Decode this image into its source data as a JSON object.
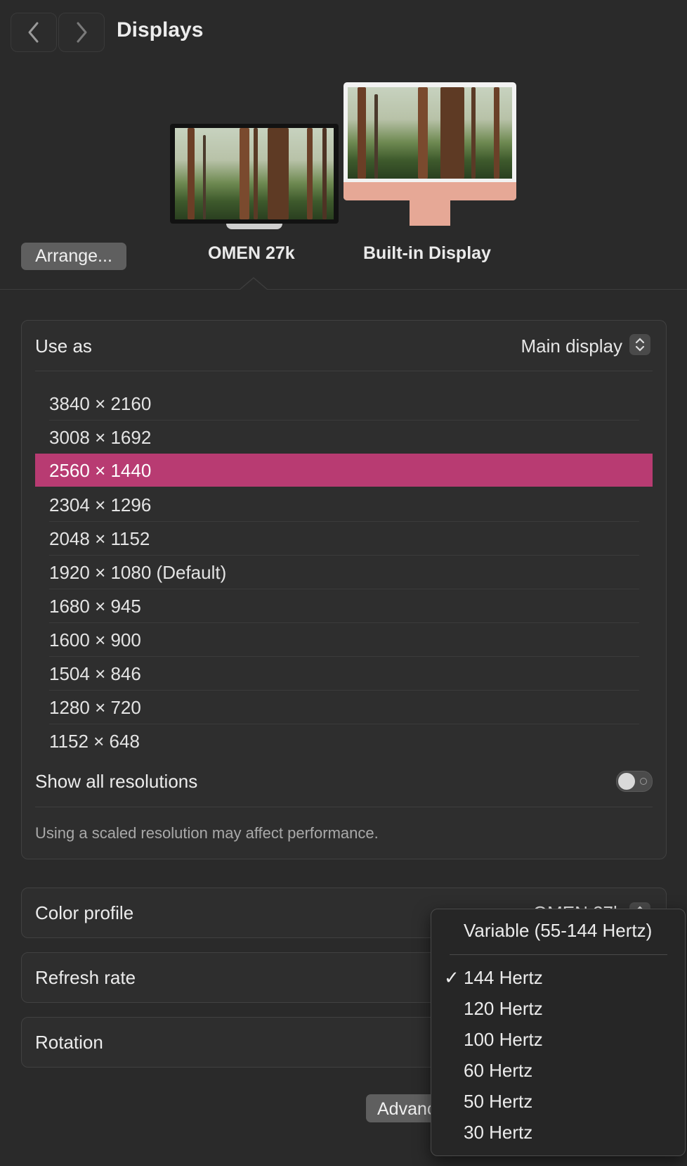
{
  "header": {
    "title": "Displays",
    "back_label": "back",
    "forward_label": "forward"
  },
  "displays": {
    "arrange_label": "Arrange...",
    "items": [
      {
        "name": "OMEN 27k",
        "selected": true
      },
      {
        "name": "Built-in Display",
        "selected": false
      }
    ]
  },
  "main_panel": {
    "use_as_label": "Use as",
    "use_as_value": "Main display",
    "resolutions": [
      "3840 × 2160",
      "3008 × 1692",
      "2560 × 1440",
      "2304 × 1296",
      "2048 × 1152",
      "1920 × 1080 (Default)",
      "1680 × 945",
      "1600 × 900",
      "1504 × 846",
      "1280 × 720",
      "1152 × 648"
    ],
    "selected_resolution": "2560 × 1440",
    "show_all_label": "Show all resolutions",
    "show_all_enabled": false,
    "note": "Using a scaled resolution may affect performance.",
    "accent_color": "#b83b72"
  },
  "settings": {
    "color_profile_label": "Color profile",
    "color_profile_value": "OMEN 27k",
    "refresh_rate_label": "Refresh rate",
    "rotation_label": "Rotation",
    "advanced_label": "Advanced..."
  },
  "refresh_menu": {
    "variable_option": "Variable (55-144 Hertz)",
    "options": [
      "144 Hertz",
      "120 Hertz",
      "100 Hertz",
      "60 Hertz",
      "50 Hertz",
      "30 Hertz"
    ],
    "checked": "144 Hertz",
    "check_glyph": "✓"
  }
}
